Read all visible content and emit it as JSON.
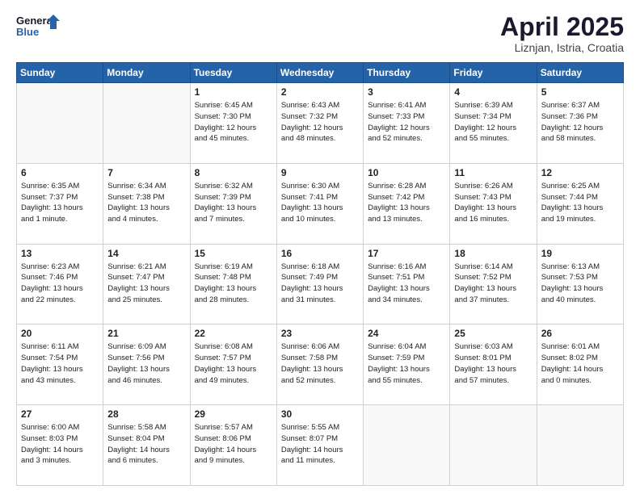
{
  "header": {
    "logo_line1": "General",
    "logo_line2": "Blue",
    "month": "April 2025",
    "location": "Liznjan, Istria, Croatia"
  },
  "days_of_week": [
    "Sunday",
    "Monday",
    "Tuesday",
    "Wednesday",
    "Thursday",
    "Friday",
    "Saturday"
  ],
  "weeks": [
    [
      {
        "num": "",
        "info": ""
      },
      {
        "num": "",
        "info": ""
      },
      {
        "num": "1",
        "info": "Sunrise: 6:45 AM\nSunset: 7:30 PM\nDaylight: 12 hours\nand 45 minutes."
      },
      {
        "num": "2",
        "info": "Sunrise: 6:43 AM\nSunset: 7:32 PM\nDaylight: 12 hours\nand 48 minutes."
      },
      {
        "num": "3",
        "info": "Sunrise: 6:41 AM\nSunset: 7:33 PM\nDaylight: 12 hours\nand 52 minutes."
      },
      {
        "num": "4",
        "info": "Sunrise: 6:39 AM\nSunset: 7:34 PM\nDaylight: 12 hours\nand 55 minutes."
      },
      {
        "num": "5",
        "info": "Sunrise: 6:37 AM\nSunset: 7:36 PM\nDaylight: 12 hours\nand 58 minutes."
      }
    ],
    [
      {
        "num": "6",
        "info": "Sunrise: 6:35 AM\nSunset: 7:37 PM\nDaylight: 13 hours\nand 1 minute."
      },
      {
        "num": "7",
        "info": "Sunrise: 6:34 AM\nSunset: 7:38 PM\nDaylight: 13 hours\nand 4 minutes."
      },
      {
        "num": "8",
        "info": "Sunrise: 6:32 AM\nSunset: 7:39 PM\nDaylight: 13 hours\nand 7 minutes."
      },
      {
        "num": "9",
        "info": "Sunrise: 6:30 AM\nSunset: 7:41 PM\nDaylight: 13 hours\nand 10 minutes."
      },
      {
        "num": "10",
        "info": "Sunrise: 6:28 AM\nSunset: 7:42 PM\nDaylight: 13 hours\nand 13 minutes."
      },
      {
        "num": "11",
        "info": "Sunrise: 6:26 AM\nSunset: 7:43 PM\nDaylight: 13 hours\nand 16 minutes."
      },
      {
        "num": "12",
        "info": "Sunrise: 6:25 AM\nSunset: 7:44 PM\nDaylight: 13 hours\nand 19 minutes."
      }
    ],
    [
      {
        "num": "13",
        "info": "Sunrise: 6:23 AM\nSunset: 7:46 PM\nDaylight: 13 hours\nand 22 minutes."
      },
      {
        "num": "14",
        "info": "Sunrise: 6:21 AM\nSunset: 7:47 PM\nDaylight: 13 hours\nand 25 minutes."
      },
      {
        "num": "15",
        "info": "Sunrise: 6:19 AM\nSunset: 7:48 PM\nDaylight: 13 hours\nand 28 minutes."
      },
      {
        "num": "16",
        "info": "Sunrise: 6:18 AM\nSunset: 7:49 PM\nDaylight: 13 hours\nand 31 minutes."
      },
      {
        "num": "17",
        "info": "Sunrise: 6:16 AM\nSunset: 7:51 PM\nDaylight: 13 hours\nand 34 minutes."
      },
      {
        "num": "18",
        "info": "Sunrise: 6:14 AM\nSunset: 7:52 PM\nDaylight: 13 hours\nand 37 minutes."
      },
      {
        "num": "19",
        "info": "Sunrise: 6:13 AM\nSunset: 7:53 PM\nDaylight: 13 hours\nand 40 minutes."
      }
    ],
    [
      {
        "num": "20",
        "info": "Sunrise: 6:11 AM\nSunset: 7:54 PM\nDaylight: 13 hours\nand 43 minutes."
      },
      {
        "num": "21",
        "info": "Sunrise: 6:09 AM\nSunset: 7:56 PM\nDaylight: 13 hours\nand 46 minutes."
      },
      {
        "num": "22",
        "info": "Sunrise: 6:08 AM\nSunset: 7:57 PM\nDaylight: 13 hours\nand 49 minutes."
      },
      {
        "num": "23",
        "info": "Sunrise: 6:06 AM\nSunset: 7:58 PM\nDaylight: 13 hours\nand 52 minutes."
      },
      {
        "num": "24",
        "info": "Sunrise: 6:04 AM\nSunset: 7:59 PM\nDaylight: 13 hours\nand 55 minutes."
      },
      {
        "num": "25",
        "info": "Sunrise: 6:03 AM\nSunset: 8:01 PM\nDaylight: 13 hours\nand 57 minutes."
      },
      {
        "num": "26",
        "info": "Sunrise: 6:01 AM\nSunset: 8:02 PM\nDaylight: 14 hours\nand 0 minutes."
      }
    ],
    [
      {
        "num": "27",
        "info": "Sunrise: 6:00 AM\nSunset: 8:03 PM\nDaylight: 14 hours\nand 3 minutes."
      },
      {
        "num": "28",
        "info": "Sunrise: 5:58 AM\nSunset: 8:04 PM\nDaylight: 14 hours\nand 6 minutes."
      },
      {
        "num": "29",
        "info": "Sunrise: 5:57 AM\nSunset: 8:06 PM\nDaylight: 14 hours\nand 9 minutes."
      },
      {
        "num": "30",
        "info": "Sunrise: 5:55 AM\nSunset: 8:07 PM\nDaylight: 14 hours\nand 11 minutes."
      },
      {
        "num": "",
        "info": ""
      },
      {
        "num": "",
        "info": ""
      },
      {
        "num": "",
        "info": ""
      }
    ]
  ]
}
